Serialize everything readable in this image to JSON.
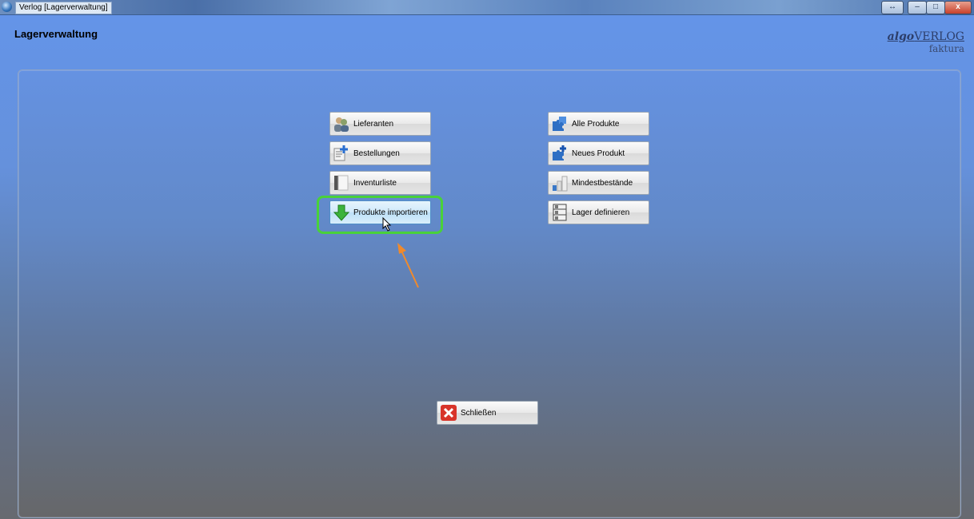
{
  "window": {
    "title": "Verlog [Lagerverwaltung]",
    "controls": {
      "restore": "↔",
      "minimize": "–",
      "maximize": "□",
      "close": "x"
    }
  },
  "page": {
    "title": "Lagerverwaltung"
  },
  "logo": {
    "brand_italic": "algo",
    "brand": "VERLOG",
    "subtitle": "faktura"
  },
  "left_buttons": [
    {
      "label": "Lieferanten",
      "icon": "suppliers-icon"
    },
    {
      "label": "Bestellungen",
      "icon": "orders-icon"
    },
    {
      "label": "Inventurliste",
      "icon": "inventory-list-icon"
    },
    {
      "label": "Produkte importieren",
      "icon": "import-arrow-down-icon",
      "state": "hover"
    }
  ],
  "right_buttons": [
    {
      "label": "Alle Produkte",
      "icon": "puzzle-icon"
    },
    {
      "label": "Neues Produkt",
      "icon": "new-puzzle-icon"
    },
    {
      "label": "Mindestbestände",
      "icon": "bar-levels-icon"
    },
    {
      "label": "Lager definieren",
      "icon": "shelf-icon"
    }
  ],
  "close_button": {
    "label": "Schließen",
    "icon": "close-x-icon"
  },
  "colors": {
    "highlight": "#49d13a",
    "annotation_arrow": "#f08a2c"
  }
}
